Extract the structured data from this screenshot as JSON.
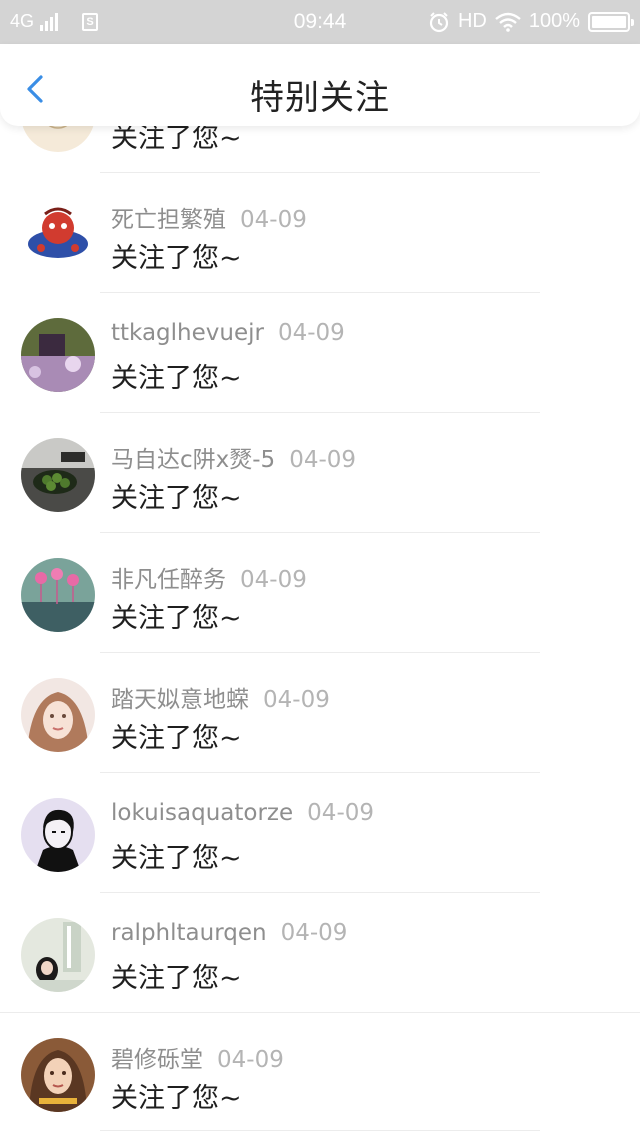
{
  "status_bar": {
    "network": "4G",
    "time": "09:44",
    "hd": "HD",
    "battery": "100%"
  },
  "nav": {
    "back_icon": "chevron-left-icon",
    "title": "特别关注"
  },
  "colors": {
    "accent": "#3a8ee6",
    "status_bar_bg": "#d4d4d4",
    "name_gray": "#8e8e8e",
    "date_gray": "#b4b4b4"
  },
  "notifications": [
    {
      "name": "",
      "date": "",
      "action": "关注了您~"
    },
    {
      "name": "死亡担繁殖",
      "date": "04-09",
      "action": "关注了您~"
    },
    {
      "name": "ttkaglhevuejr",
      "date": "04-09",
      "action": "关注了您~"
    },
    {
      "name": "马自达c阱x燹-5",
      "date": "04-09",
      "action": "关注了您~"
    },
    {
      "name": "非凡任醉务",
      "date": "04-09",
      "action": "关注了您~"
    },
    {
      "name": "踏天姒意地蝾",
      "date": "04-09",
      "action": "关注了您~"
    },
    {
      "name": "lokuisaquatorze",
      "date": "04-09",
      "action": "关注了您~"
    },
    {
      "name": "ralphltaurqen",
      "date": "04-09",
      "action": "关注了您~"
    },
    {
      "name": "碧修砾堂",
      "date": "04-09",
      "action": "关注了您~"
    }
  ]
}
